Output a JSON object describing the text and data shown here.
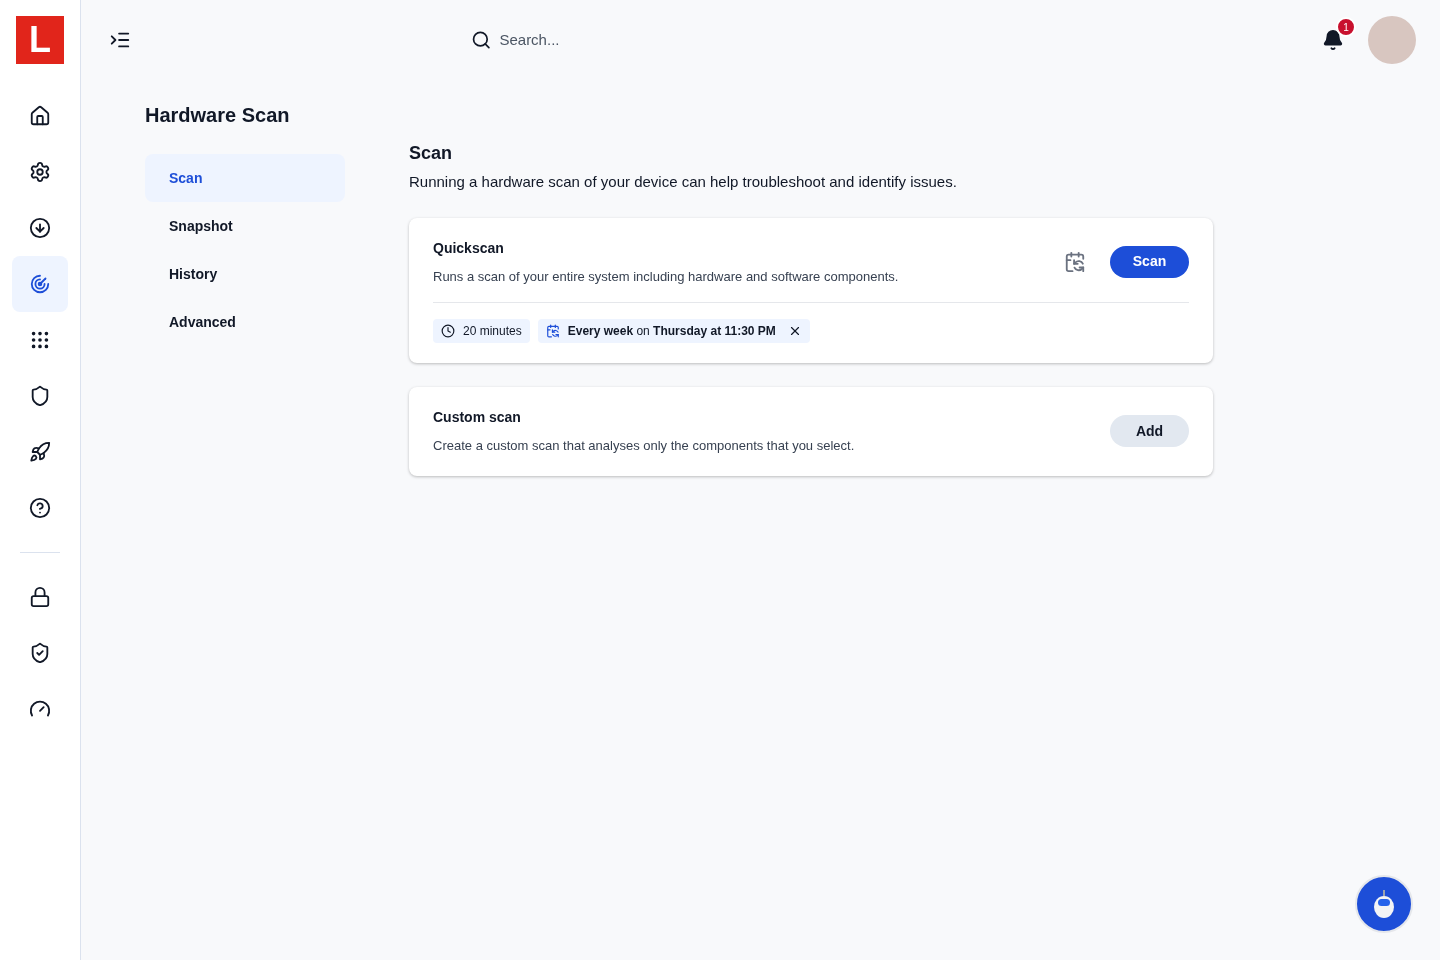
{
  "logo": "L",
  "rail": {
    "groups": [
      [
        {
          "selected": false
        },
        {
          "selected": false
        },
        {
          "selected": false
        },
        {
          "selected": true
        },
        {
          "selected": false
        },
        {
          "selected": false
        },
        {
          "selected": false
        },
        {
          "selected": false
        }
      ],
      [
        {
          "selected": false
        },
        {
          "selected": false
        },
        {
          "selected": false
        }
      ]
    ]
  },
  "search": {
    "placeholder": "Search..."
  },
  "notifications": {
    "count": "1"
  },
  "page_title": "Hardware Scan",
  "subnav": [
    {
      "label": "Scan",
      "selected": true
    },
    {
      "label": "Snapshot",
      "selected": false
    },
    {
      "label": "History",
      "selected": false
    },
    {
      "label": "Advanced",
      "selected": false
    }
  ],
  "section": {
    "title": "Scan",
    "description": "Running a hardware scan of your device can help troubleshoot and identify issues."
  },
  "cards": [
    {
      "title": "Quickscan",
      "description": "Runs a scan of your entire system including hardware and software components.",
      "schedule_button": true,
      "button": {
        "label": "Scan",
        "kind": "primary"
      },
      "tags": [
        {
          "kind": "duration",
          "text": "20 minutes",
          "removable": false
        },
        {
          "kind": "schedule",
          "text": "**Every week** on **Thursday at 11:30 PM**",
          "removable": true
        }
      ]
    },
    {
      "title": "Custom scan",
      "description": "Create a custom scan that analyses only the components that you select.",
      "schedule_button": false,
      "button": {
        "label": "Add",
        "kind": "secondary"
      }
    }
  ]
}
